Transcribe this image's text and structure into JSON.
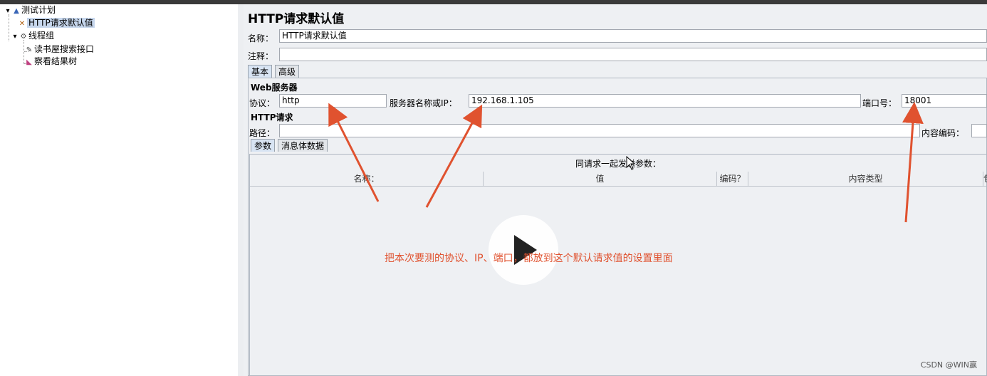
{
  "tree": {
    "root": "测试计划",
    "items": [
      {
        "label": "HTTP请求默认值",
        "selected": true
      },
      {
        "label": "线程组"
      },
      {
        "label": "读书屋搜索接口"
      },
      {
        "label": "察看结果树"
      }
    ]
  },
  "panel": {
    "title": "HTTP请求默认值",
    "name_label": "名称：",
    "name_value": "HTTP请求默认值",
    "comment_label": "注释：",
    "comment_value": "",
    "tabs": [
      "基本",
      "高级"
    ],
    "web_server": {
      "section": "Web服务器",
      "protocol_label": "协议：",
      "protocol_value": "http",
      "server_label": "服务器名称或IP：",
      "server_value": "192.168.1.105",
      "port_label": "端口号：",
      "port_value": "18001"
    },
    "http_request": {
      "section": "HTTP请求",
      "path_label": "路径：",
      "path_value": "",
      "encoding_label": "内容编码："
    },
    "subtabs": [
      "参数",
      "消息体数据"
    ],
    "params": {
      "caption": "同请求一起发送参数：",
      "columns": [
        "名称：",
        "值",
        "编码？",
        "内容类型",
        "包"
      ]
    }
  },
  "annotation": "把本次要测的协议、IP、端口，都放到这个默认请求值的设置里面",
  "watermark": "CSDN @WIN赢",
  "colors": {
    "annotation": "#e0522f",
    "selection": "#c6d6ec"
  },
  "icons": [
    "play-icon",
    "test-plan-icon",
    "thread-group-icon",
    "sampler-icon",
    "listener-icon",
    "config-icon",
    "mouse-cursor-icon"
  ]
}
